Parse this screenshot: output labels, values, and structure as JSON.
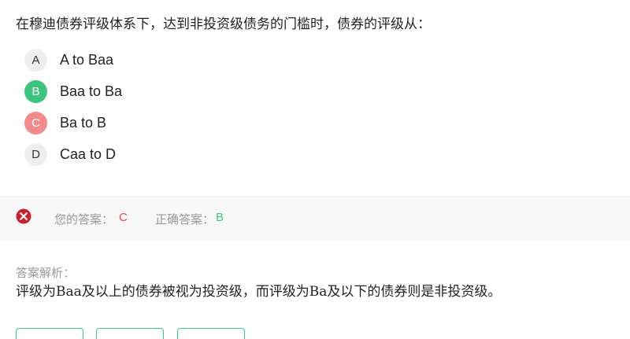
{
  "question": {
    "text": "在穆迪债券评级体系下，达到非投资级债务的门槛时，债券的评级从："
  },
  "options": [
    {
      "letter": "A",
      "text": "A to Baa",
      "state": "normal"
    },
    {
      "letter": "B",
      "text": "Baa to Ba",
      "state": "correct"
    },
    {
      "letter": "C",
      "text": "Ba to B",
      "state": "wrong"
    },
    {
      "letter": "D",
      "text": "Caa to D",
      "state": "normal"
    }
  ],
  "result": {
    "icon": "wrong-x-icon",
    "your_answer_label": "您的答案：",
    "your_answer": "C",
    "correct_answer_label": "正确答案：",
    "correct_answer": "B"
  },
  "analysis": {
    "title": "答案解析：",
    "text": "评级为Baa及以上的债券被视为投资级，而评级为Ba及以下的债券则是非投资级。"
  },
  "colors": {
    "correct": "#3dc47e",
    "wrong_option": "#f28b8b",
    "wrong_text": "#e84a4a",
    "wrong_icon": "#c8212b",
    "result_bg": "#f7f7f7"
  }
}
